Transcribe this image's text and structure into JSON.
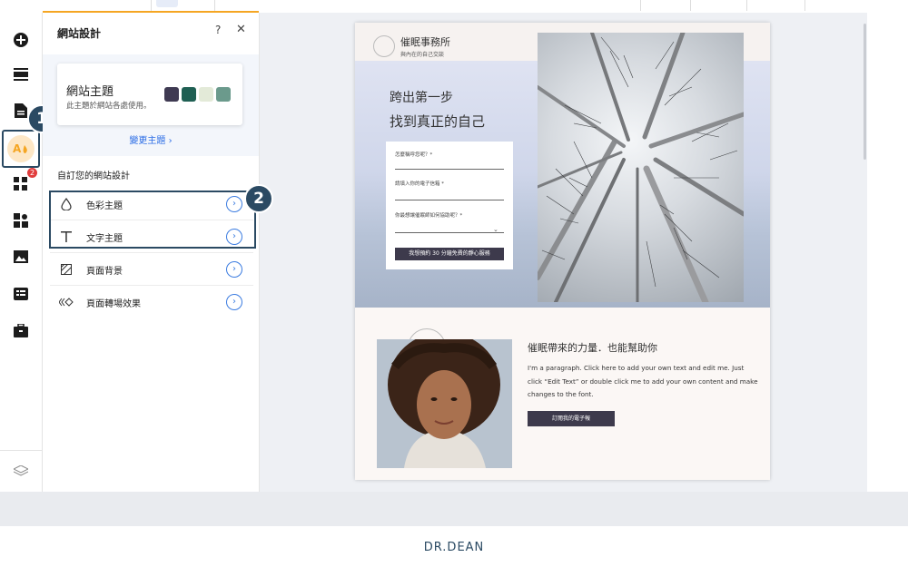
{
  "panel": {
    "title": "網站設計",
    "help": "?",
    "close": "✕",
    "theme_card": {
      "title": "網站主題",
      "subtitle": "此主題於網站各處使用。",
      "swatches": [
        "#3f3a52",
        "#1f5f53",
        "#e3ead8",
        "#6b9a8c"
      ]
    },
    "change_theme": "變更主題 ›",
    "customize_title": "自訂您的網站設計",
    "options": [
      {
        "label": "色彩主題",
        "icon": "droplet-icon"
      },
      {
        "label": "文字主題",
        "icon": "text-icon"
      },
      {
        "label": "頁面背景",
        "icon": "background-icon"
      },
      {
        "label": "頁面轉場效果",
        "icon": "transition-icon"
      }
    ],
    "arrow": "›"
  },
  "rail": {
    "notif_count": "2",
    "accent": "#f5a623"
  },
  "callouts": [
    "1",
    "2"
  ],
  "site": {
    "logo_name": "催眠事務所",
    "logo_tag": "與內在的自己交談",
    "hero_line1": "跨出第一步",
    "hero_line2": "找到真正的自己",
    "form": {
      "field1": "怎麼稱呼您呢？*",
      "field2": "請填入你的電子信箱 *",
      "field3": "你最想讓催眠師如何協助呢？*",
      "button": "我想預約 30 分鐘免費的靜心服務"
    },
    "section2_title": "催眠帶來的力量．也能幫助你",
    "section2_para": "I'm a paragraph. Click here to add your own text and edit me.  Just click “Edit Text” or double click me to add your own content and make changes to the font.",
    "section2_button": "訂閱我的電子報"
  },
  "brand": "DR.DEAN"
}
